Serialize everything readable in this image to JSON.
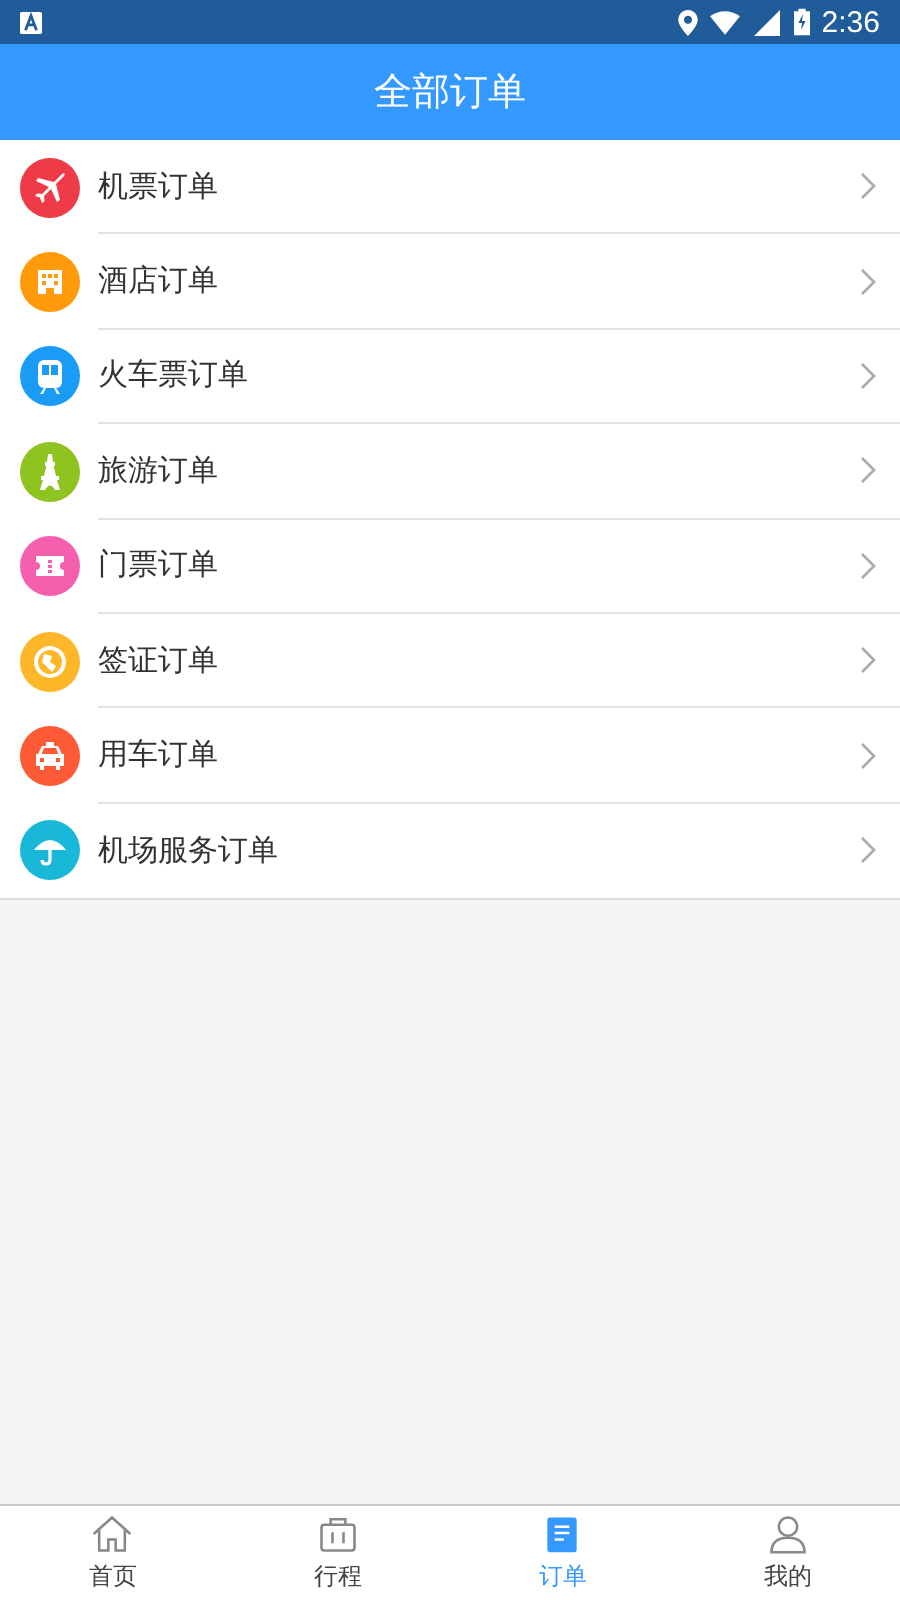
{
  "status_bar": {
    "time": "2:36"
  },
  "header": {
    "title": "全部订单"
  },
  "orders": [
    {
      "label": "机票订单",
      "kind": "plane",
      "color": "#ef3b47"
    },
    {
      "label": "酒店订单",
      "kind": "hotel",
      "color": "#ff9a0a"
    },
    {
      "label": "火车票订单",
      "kind": "train",
      "color": "#1a9bf5"
    },
    {
      "label": "旅游订单",
      "kind": "tower",
      "color": "#8fc31f"
    },
    {
      "label": "门票订单",
      "kind": "ticket",
      "color": "#f45fae"
    },
    {
      "label": "签证订单",
      "kind": "globe",
      "color": "#ffb72a"
    },
    {
      "label": "用车订单",
      "kind": "taxi",
      "color": "#ff5a36"
    },
    {
      "label": "机场服务订单",
      "kind": "umbrella",
      "color": "#19b7d8"
    }
  ],
  "tab_bar": [
    {
      "label": "首页",
      "kind": "home",
      "selected": false
    },
    {
      "label": "行程",
      "kind": "suitcase",
      "selected": false
    },
    {
      "label": "订单",
      "kind": "clipboard",
      "selected": true
    },
    {
      "label": "我的",
      "kind": "person",
      "selected": false
    }
  ]
}
